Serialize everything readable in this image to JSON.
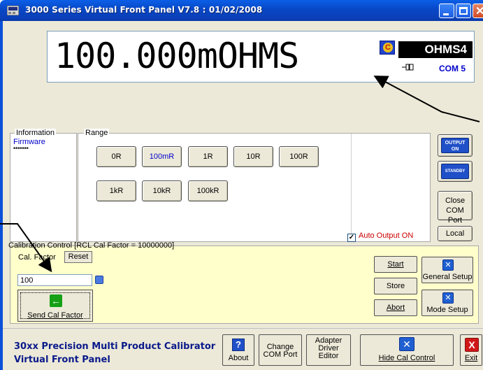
{
  "window": {
    "title": "3000 Series Virtual Front Panel V7.8 : 01/02/2008"
  },
  "display": {
    "reading": "100.000mOHMS",
    "mode": "OHMS4",
    "com": "COM 5"
  },
  "information": {
    "title": "Information",
    "firmware_label": "Firmware",
    "firmware_value": "*******"
  },
  "range": {
    "title": "Range",
    "buttons": [
      "0R",
      "100mR",
      "1R",
      "10R",
      "100R",
      "1kR",
      "10kR",
      "100kR"
    ],
    "selected": "100mR",
    "auto_output_label": "Auto Output ON",
    "auto_output_checked": true
  },
  "side_buttons": {
    "output_on": "OUTPUT ON",
    "output_line1": "OUTPUT",
    "output_line2": "ON",
    "standby": "STANDBY",
    "close_com_line1": "Close",
    "close_com_line2": "COM Port",
    "local": "Local"
  },
  "calibration": {
    "title": "Calibration Control [RCL Cal Factor = 10000000]",
    "cal_factor_label": "Cal. Factor",
    "reset_label": "Reset",
    "input_value": "100",
    "send_label": "Send Cal Factor",
    "start_label": "Start",
    "store_label": "Store",
    "abort_label": "Abort",
    "general_setup_label": "General Setup",
    "mode_setup_label": "Mode Setup"
  },
  "bottom": {
    "product_line1": "30xx Precision Multi Product Calibrator",
    "product_line2": "Virtual Front Panel",
    "about_label": "About",
    "change_com_line1": "Change",
    "change_com_line2": "COM Port",
    "adapter_line1": "Adapter",
    "adapter_line2": "Driver",
    "adapter_line3": "Editor",
    "hide_cal_label": "Hide Cal Control",
    "exit_label": "Exit"
  },
  "colors": {
    "titlebar": "#0a5fe6",
    "panel": "#ece9d8",
    "cal_panel": "#ffffcc",
    "accent_blue": "#0000cc",
    "auto_output_red": "#cc0000"
  },
  "icons": [
    "app-icon",
    "minimize-icon",
    "maximize-icon",
    "close-icon",
    "calibrator-logo-icon",
    "plug-icon",
    "info-icon",
    "green-arrow-icon",
    "setup-tools-icon",
    "help-icon",
    "exit-icon"
  ]
}
